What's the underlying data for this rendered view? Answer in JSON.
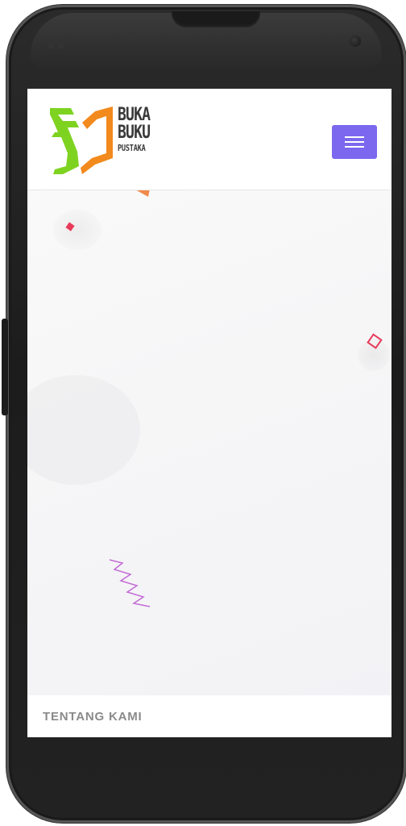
{
  "brand": {
    "logo_line1": "BUKA",
    "logo_line2": "BUKU",
    "logo_line3": "PUSTAKA",
    "colors": {
      "logo_green": "#7ed321",
      "logo_orange": "#f28a1d",
      "menu_purple": "#7b68ee"
    }
  },
  "header": {
    "menu_icon": "hamburger-menu-icon"
  },
  "hero": {
    "decorations": [
      "triangle-orange",
      "diamond-red",
      "diamond-outline-red",
      "circle-gray",
      "zigzag-purple"
    ]
  },
  "section": {
    "title": "TENTANG KAMI"
  }
}
